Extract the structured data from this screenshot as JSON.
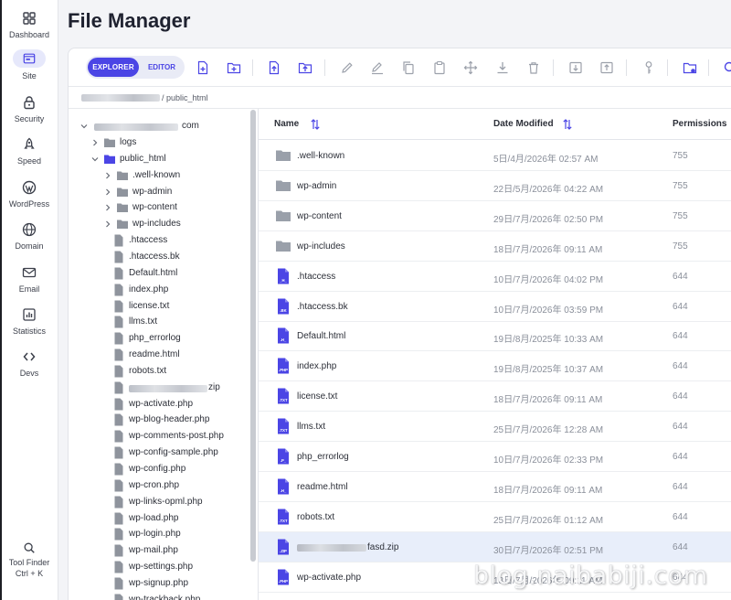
{
  "nav": {
    "items": [
      {
        "label": "Dashboard",
        "icon": "dashboard-icon"
      },
      {
        "label": "Site",
        "icon": "site-icon"
      },
      {
        "label": "Security",
        "icon": "lock-icon"
      },
      {
        "label": "Speed",
        "icon": "rocket-icon"
      },
      {
        "label": "WordPress",
        "icon": "wordpress-icon"
      },
      {
        "label": "Domain",
        "icon": "globe-icon"
      },
      {
        "label": "Email",
        "icon": "mail-icon"
      },
      {
        "label": "Statistics",
        "icon": "chart-icon"
      },
      {
        "label": "Devs",
        "icon": "code-icon"
      }
    ],
    "tool_finder": {
      "label": "Tool Finder",
      "shortcut": "Ctrl + K"
    }
  },
  "page": {
    "title": "File Manager"
  },
  "toolbar": {
    "explorer": "EXPLORER",
    "editor": "EDITOR"
  },
  "breadcrumb": {
    "current": "/ public_html"
  },
  "tree": {
    "root_suffix": "com",
    "items": [
      {
        "label": "logs",
        "type": "folder",
        "expanded": false
      },
      {
        "label": "public_html",
        "type": "folder",
        "expanded": true
      },
      {
        "label": ".well-known",
        "type": "folder",
        "expanded": false
      },
      {
        "label": "wp-admin",
        "type": "folder",
        "expanded": false
      },
      {
        "label": "wp-content",
        "type": "folder",
        "expanded": false
      },
      {
        "label": "wp-includes",
        "type": "folder",
        "expanded": false
      },
      {
        "label": ".htaccess",
        "type": "file"
      },
      {
        "label": ".htaccess.bk",
        "type": "file"
      },
      {
        "label": "Default.html",
        "type": "file"
      },
      {
        "label": "index.php",
        "type": "file"
      },
      {
        "label": "license.txt",
        "type": "file"
      },
      {
        "label": "llms.txt",
        "type": "file"
      },
      {
        "label": "php_errorlog",
        "type": "file"
      },
      {
        "label": "readme.html",
        "type": "file"
      },
      {
        "label": "robots.txt",
        "type": "file"
      },
      {
        "label": "zip",
        "type": "file"
      },
      {
        "label": "wp-activate.php",
        "type": "file"
      },
      {
        "label": "wp-blog-header.php",
        "type": "file"
      },
      {
        "label": "wp-comments-post.php",
        "type": "file"
      },
      {
        "label": "wp-config-sample.php",
        "type": "file"
      },
      {
        "label": "wp-config.php",
        "type": "file"
      },
      {
        "label": "wp-cron.php",
        "type": "file"
      },
      {
        "label": "wp-links-opml.php",
        "type": "file"
      },
      {
        "label": "wp-load.php",
        "type": "file"
      },
      {
        "label": "wp-login.php",
        "type": "file"
      },
      {
        "label": "wp-mail.php",
        "type": "file"
      },
      {
        "label": "wp-settings.php",
        "type": "file"
      },
      {
        "label": "wp-signup.php",
        "type": "file"
      },
      {
        "label": "wp-trackback.php",
        "type": "file"
      }
    ]
  },
  "table": {
    "headers": {
      "name": "Name",
      "date": "Date Modified",
      "permissions": "Permissions"
    },
    "rows": [
      {
        "name": ".well-known",
        "date": "5日/4月/2026年 02:57 AM",
        "perm": "755",
        "kind": "folder"
      },
      {
        "name": "wp-admin",
        "date": "22日/5月/2026年 04:22 AM",
        "perm": "755",
        "kind": "folder"
      },
      {
        "name": "wp-content",
        "date": "29日/7月/2026年 02:50 PM",
        "perm": "755",
        "kind": "folder"
      },
      {
        "name": "wp-includes",
        "date": "18日/7月/2026年 09:11 AM",
        "perm": "755",
        "kind": "folder"
      },
      {
        "name": ".htaccess",
        "date": "10日/7月/2026年 04:02 PM",
        "perm": "644",
        "kind": "file",
        "badge": "_H_"
      },
      {
        "name": ".htaccess.bk",
        "date": "10日/7月/2026年 03:59 PM",
        "perm": "644",
        "kind": "file",
        "badge": ".BK"
      },
      {
        "name": "Default.html",
        "date": "19日/8月/2025年 10:33 AM",
        "perm": "644",
        "kind": "file",
        "badge": ".H_"
      },
      {
        "name": "index.php",
        "date": "19日/8月/2025年 10:37 AM",
        "perm": "644",
        "kind": "file",
        "badge": ".PHP"
      },
      {
        "name": "license.txt",
        "date": "18日/7月/2026年 09:11 AM",
        "perm": "644",
        "kind": "file",
        "badge": ".TXT"
      },
      {
        "name": "llms.txt",
        "date": "25日/7月/2026年 12:28 AM",
        "perm": "644",
        "kind": "file",
        "badge": ".TXT"
      },
      {
        "name": "php_errorlog",
        "date": "10日/7月/2026年 02:33 PM",
        "perm": "644",
        "kind": "file",
        "badge": ".P_"
      },
      {
        "name": "readme.html",
        "date": "18日/7月/2026年 09:11 AM",
        "perm": "644",
        "kind": "file",
        "badge": ".H_"
      },
      {
        "name": "robots.txt",
        "date": "25日/7月/2026年 01:12 AM",
        "perm": "644",
        "kind": "file",
        "badge": ".TXT"
      },
      {
        "name": "fasd.zip",
        "date": "30日/7月/2026年 02:51 PM",
        "perm": "644",
        "kind": "file",
        "badge": ".ZIP",
        "selected": true
      },
      {
        "name": "wp-activate.php",
        "date": "18日/7月/2026年 09:11 AM",
        "perm": "644",
        "kind": "file",
        "badge": ".PHP"
      }
    ]
  },
  "watermark": "blog.naibabiji.com",
  "colors": {
    "accent": "#4b45e5",
    "folder": "#9aa0aa",
    "selected_row": "#e8eefa"
  }
}
